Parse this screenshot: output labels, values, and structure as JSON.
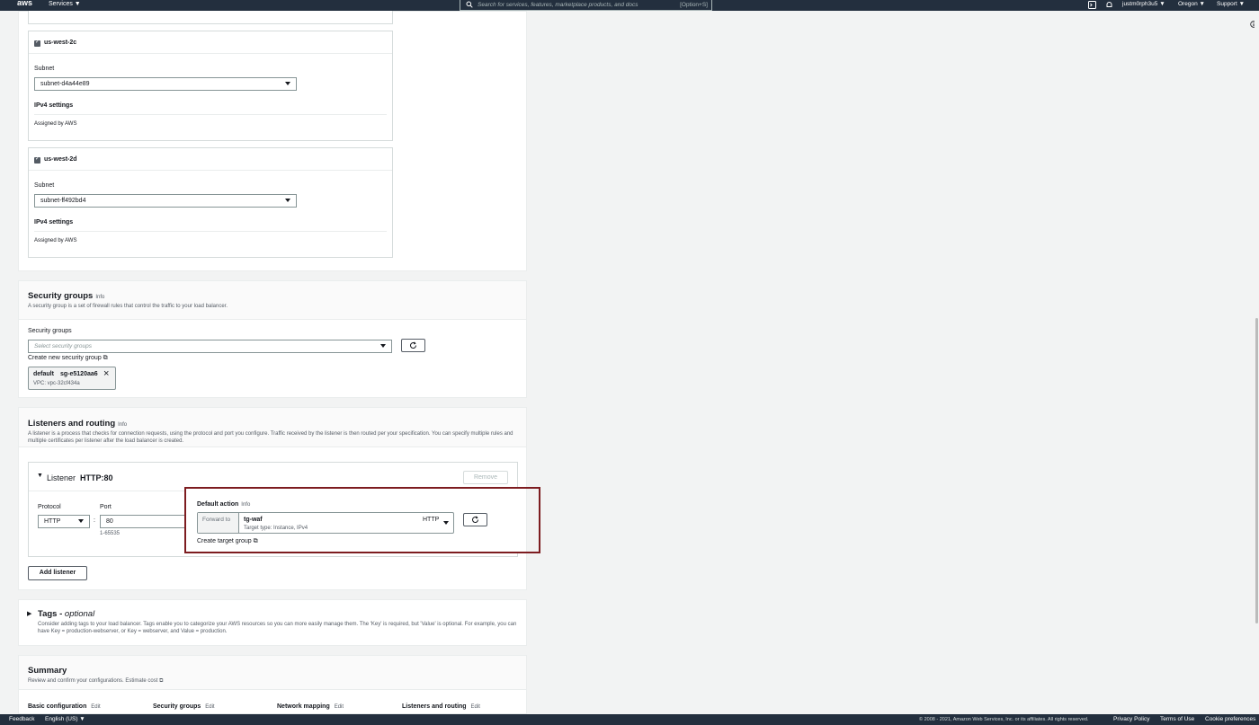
{
  "topnav": {
    "logo": "aws",
    "services": "Services ▼",
    "search_placeholder": "Search for services, features, marketplace products, and docs",
    "search_shortcut": "[Option+S]",
    "user": "justm0rph3u5 ▼",
    "region": "Oregon ▼",
    "support": "Support ▼"
  },
  "mapping": {
    "zones": [
      {
        "name": "us-west-2c",
        "subnet_label": "Subnet",
        "subnet_value": "subnet-d4a44e89",
        "ipv4_label": "IPv4 settings",
        "ipv4_value": "Assigned by AWS"
      },
      {
        "name": "us-west-2d",
        "subnet_label": "Subnet",
        "subnet_value": "subnet-ff492bd4",
        "ipv4_label": "IPv4 settings",
        "ipv4_value": "Assigned by AWS"
      }
    ]
  },
  "security": {
    "title": "Security groups",
    "info": "Info",
    "description": "A security group is a set of firewall rules that control the traffic to your load balancer.",
    "field_label": "Security groups",
    "placeholder": "Select security groups",
    "create_link": "Create new security group",
    "token_name": "default",
    "token_id": "sg-e5120aa6",
    "token_vpc": "VPC: vpc-32cf434a"
  },
  "listeners": {
    "title": "Listeners and routing",
    "info": "Info",
    "description": "A listener is a process that checks for connection requests, using the protocol and port you configure. Traffic received by the listener is then routed per your specification. You can specify multiple rules and multiple certificates per listener after the load balancer is created.",
    "listener_label": "Listener",
    "listener_value": "HTTP:80",
    "remove": "Remove",
    "protocol_label": "Protocol",
    "protocol_value": "HTTP",
    "port_label": "Port",
    "port_value": "80",
    "port_hint": "1-65535",
    "default_action_label": "Default action",
    "default_action_info": "Info",
    "forward_to": "Forward to",
    "target_name": "tg-waf",
    "target_protocol": "HTTP",
    "target_type": "Target type: Instance, IPv4",
    "create_target": "Create target group",
    "add_listener": "Add listener"
  },
  "tags": {
    "title": "Tags -",
    "optional": "optional",
    "description": "Consider adding tags to your load balancer. Tags enable you to categorize your AWS resources so you can more easily manage them. The 'Key' is required, but 'Value' is optional. For example, you can have Key = production-webserver, or Key = webserver, and Value = production."
  },
  "summary": {
    "title": "Summary",
    "description": "Review and confirm your configurations.",
    "estimate": "Estimate cost",
    "columns": [
      {
        "title": "Basic configuration",
        "edit": "Edit"
      },
      {
        "title": "Security groups",
        "edit": "Edit"
      },
      {
        "title": "Network mapping",
        "edit": "Edit"
      },
      {
        "title": "Listeners and routing",
        "edit": "Edit"
      }
    ]
  },
  "footer": {
    "feedback": "Feedback",
    "language": "English (US) ▼",
    "copyright": "© 2008 - 2021, Amazon Web Services, Inc. or its affiliates. All rights reserved.",
    "privacy": "Privacy Policy",
    "terms": "Terms of Use",
    "cookies": "Cookie preferences"
  },
  "colors": {
    "nav": "#232f3e",
    "highlight": "#7d1c20"
  }
}
